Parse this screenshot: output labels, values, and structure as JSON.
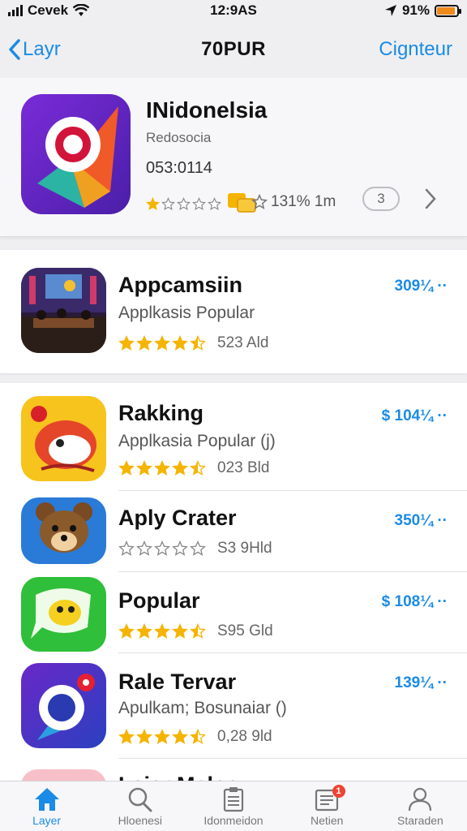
{
  "status_bar": {
    "carrier": "Cevek",
    "time": "12:9AS",
    "battery": "91%",
    "battery_level": 0.91
  },
  "nav": {
    "back_label": "Layr",
    "title": "70PUR",
    "action_label": "Cignteur"
  },
  "featured": {
    "name": "INidonelsia",
    "subtitle": "Redosocia",
    "date": "053:0114",
    "stats": "131% 1m",
    "get_label": "3",
    "rating": 1
  },
  "apps": [
    {
      "name": "Appcamsiin",
      "subtitle": "Applkasis Popular",
      "rating_count": "523 Ald",
      "price": "309¼ ··",
      "rating": 4.5,
      "icon": "movie-theater-icon"
    },
    {
      "name": "Rakking",
      "subtitle": "Applkasia Popular (j)",
      "rating_count": "023 Bld",
      "price": "$ 104¼ ··",
      "rating": 4.5,
      "icon": "fox-mascot-icon"
    },
    {
      "name": "Aply Crater",
      "subtitle": "",
      "rating_count": "S3 9Hld",
      "price": "350¼ ··",
      "rating": 0,
      "icon": "bear-mascot-icon"
    },
    {
      "name": "Popular",
      "subtitle": "",
      "rating_count": "S95 Gld",
      "price": "$ 108¼ ··",
      "rating": 4.5,
      "icon": "chat-creature-icon"
    },
    {
      "name": "Rale Tervar",
      "subtitle": "Apulkam; Bosunaiar ()",
      "rating_count": "0,28 9ld",
      "price": "139¼ ··",
      "rating": 4.5,
      "icon": "camera-lens-icon"
    },
    {
      "name": "Laiar Mcloe",
      "subtitle": "",
      "rating_count": "",
      "price": "",
      "rating": 0,
      "icon": "partial-app-icon"
    }
  ],
  "tabs": [
    {
      "label": "Layer",
      "icon": "home-icon",
      "active": true
    },
    {
      "label": "Hloenesi",
      "icon": "search-icon",
      "active": false
    },
    {
      "label": "Idonmeidon",
      "icon": "clipboard-icon",
      "active": false
    },
    {
      "label": "Netien",
      "icon": "news-icon",
      "active": false,
      "badge": "1"
    },
    {
      "label": "Staraden",
      "icon": "person-icon",
      "active": false
    }
  ],
  "colors": {
    "accent": "#1a8be6",
    "star": "#f5b400",
    "star_empty": "#888888"
  }
}
